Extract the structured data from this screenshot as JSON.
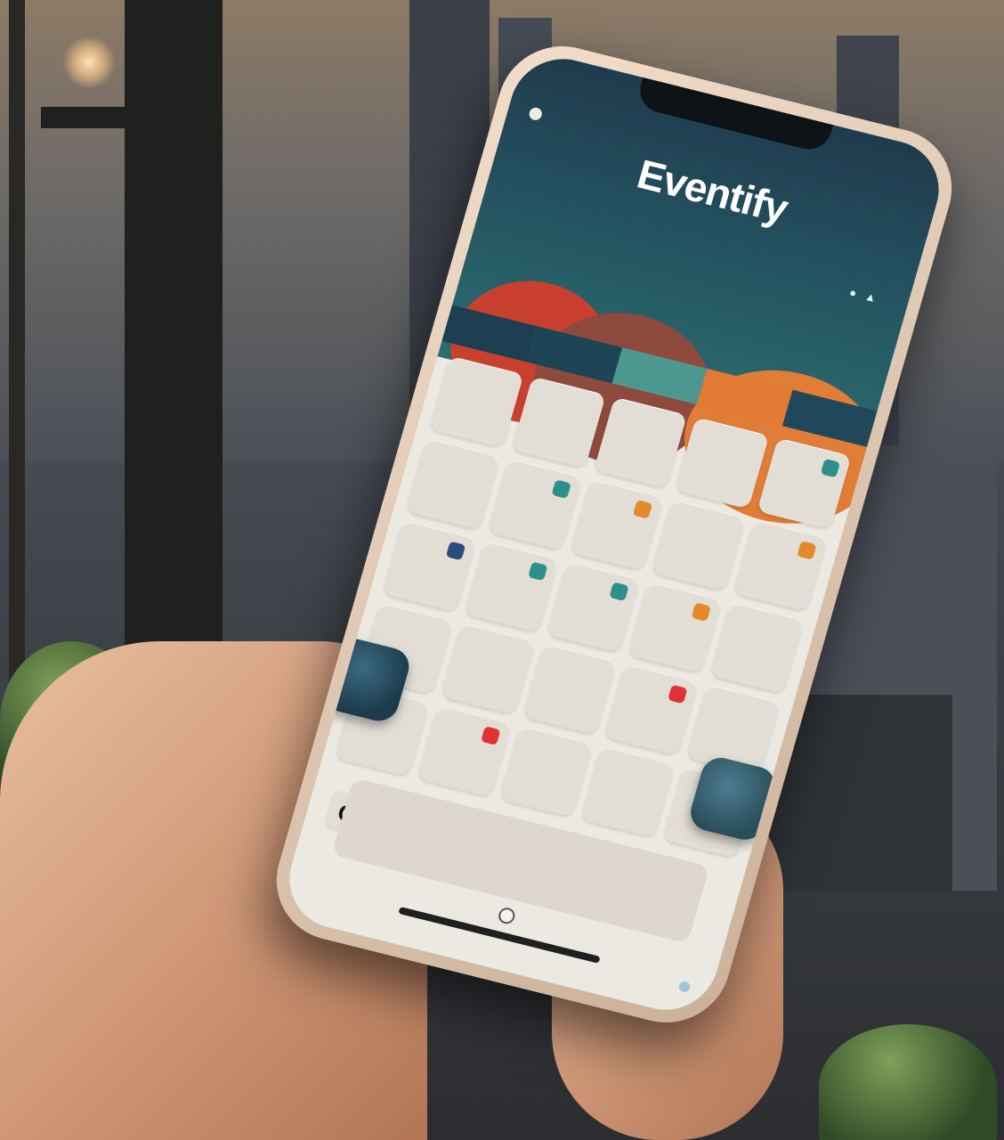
{
  "app": {
    "title": "Eventify"
  },
  "status_bar": {
    "left": "",
    "right": ""
  },
  "tabs": [
    {
      "label": "",
      "color": "#1e3f52"
    },
    {
      "label": "",
      "color": "#1e4556"
    },
    {
      "label": "",
      "color": "#4e9690"
    },
    {
      "label": "",
      "color": "#e37a33"
    },
    {
      "label": "",
      "color": "#20485a"
    }
  ],
  "calendar": {
    "days": [
      {
        "num": "",
        "marker": null
      },
      {
        "num": "",
        "marker": null
      },
      {
        "num": "",
        "marker": null
      },
      {
        "num": "",
        "marker": null
      },
      {
        "num": "",
        "marker": "#2f8f8a"
      },
      {
        "num": "",
        "marker": null
      },
      {
        "num": "",
        "marker": "#2f8f8a"
      },
      {
        "num": "",
        "marker": "#e58a2b"
      },
      {
        "num": "",
        "marker": null
      },
      {
        "num": "",
        "marker": "#e58a2b"
      },
      {
        "num": "",
        "marker": "#2b4c7e"
      },
      {
        "num": "",
        "marker": "#2f8f8a"
      },
      {
        "num": "",
        "marker": "#2f8f8a"
      },
      {
        "num": "",
        "marker": "#e58a2b"
      },
      {
        "num": "",
        "marker": null
      },
      {
        "num": "",
        "marker": null
      },
      {
        "num": "",
        "marker": null
      },
      {
        "num": "",
        "marker": null
      },
      {
        "num": "",
        "marker": "#e03232"
      },
      {
        "num": "",
        "marker": null
      },
      {
        "num": "",
        "marker": null
      },
      {
        "num": "",
        "marker": "#e03232"
      },
      {
        "num": "",
        "marker": null
      },
      {
        "num": "",
        "marker": null
      },
      {
        "num": "",
        "marker": null
      }
    ]
  },
  "badge": "OF",
  "icons": {
    "back": "back-icon",
    "share": "share-icon",
    "menu": "menu-icon",
    "fab_left": "app-icon",
    "fab_right": "app-icon"
  }
}
